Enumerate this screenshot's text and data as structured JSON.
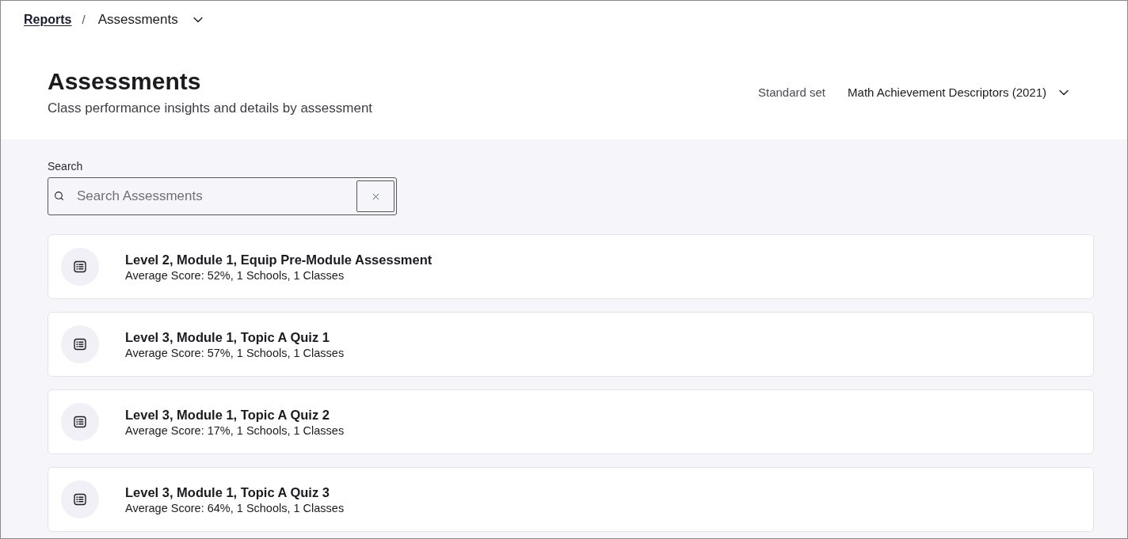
{
  "breadcrumb": {
    "parent": "Reports",
    "separator": "/",
    "current": "Assessments"
  },
  "header": {
    "title": "Assessments",
    "subtitle": "Class performance insights and details by assessment"
  },
  "standard_set": {
    "label": "Standard set",
    "value": "Math Achievement Descriptors (2021)"
  },
  "search": {
    "label": "Search",
    "placeholder": "Search Assessments"
  },
  "assessments": [
    {
      "title": "Level 2, Module 1, Equip Pre-Module Assessment",
      "summary": "Average Score: 52%, 1 Schools, 1 Classes"
    },
    {
      "title": "Level 3, Module 1, Topic A Quiz 1",
      "summary": "Average Score: 57%, 1 Schools, 1 Classes"
    },
    {
      "title": "Level 3, Module 1, Topic A Quiz 2",
      "summary": "Average Score: 17%, 1 Schools, 1 Classes"
    },
    {
      "title": "Level 3, Module 1, Topic A Quiz 3",
      "summary": "Average Score: 64%, 1 Schools, 1 Classes"
    }
  ]
}
